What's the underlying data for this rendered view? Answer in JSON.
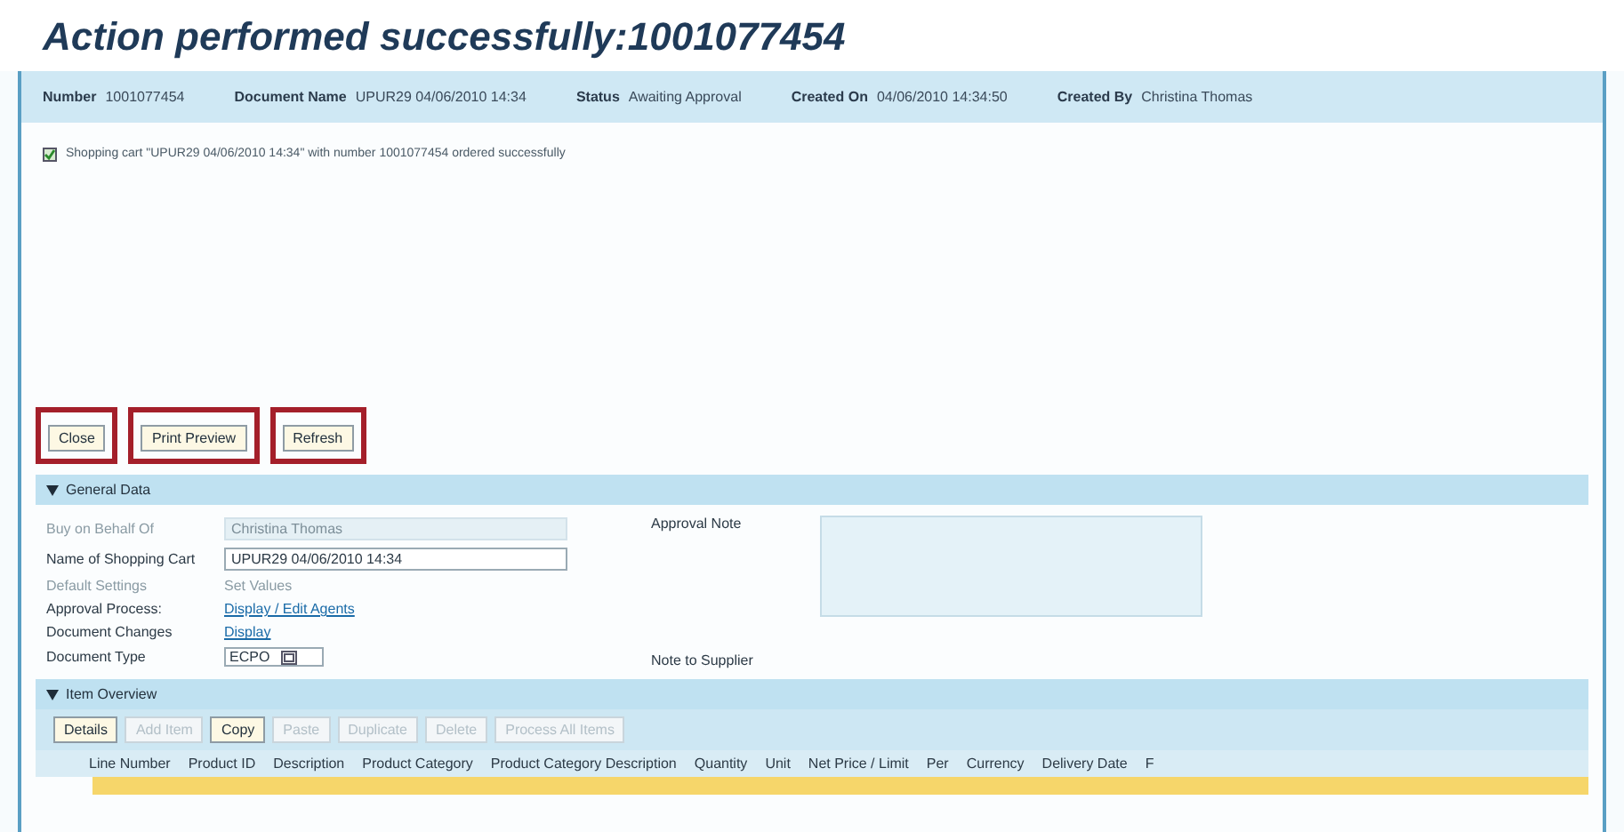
{
  "title": "Action performed successfully:1001077454",
  "header_fields": [
    {
      "label": "Number",
      "value": "1001077454"
    },
    {
      "label": "Document Name",
      "value": "UPUR29 04/06/2010 14:34"
    },
    {
      "label": "Status",
      "value": "Awaiting Approval"
    },
    {
      "label": "Created On",
      "value": "04/06/2010 14:34:50"
    },
    {
      "label": "Created By",
      "value": "Christina Thomas"
    }
  ],
  "message": {
    "kind": "success",
    "text": "Shopping cart \"UPUR29 04/06/2010 14:34\" with number 1001077454 ordered successfully"
  },
  "buttons": [
    {
      "label": "Close",
      "highlighted": true
    },
    {
      "label": "Print Preview",
      "highlighted": true
    },
    {
      "label": "Refresh",
      "highlighted": true
    }
  ],
  "general_data": {
    "title": "General Data",
    "expanded": true,
    "fields": [
      {
        "kind": "input",
        "label": "Buy on Behalf Of",
        "value": "Christina Thomas",
        "disabled": true
      },
      {
        "kind": "input",
        "label": "Name of Shopping Cart",
        "value": "UPUR29 04/06/2010 14:34",
        "disabled": false
      },
      {
        "kind": "text",
        "label": "Default Settings",
        "value": "Set Values",
        "disabled": true
      },
      {
        "kind": "link",
        "label": "Approval Process:",
        "value": "Display / Edit Agents",
        "disabled": false
      },
      {
        "kind": "link",
        "label": "Document Changes",
        "value": "Display",
        "disabled": false
      },
      {
        "kind": "select",
        "label": "Document Type",
        "value": "ECPO",
        "disabled": false
      }
    ],
    "approval_note": {
      "label": "Approval Note"
    },
    "note_to_supplier": {
      "label": "Note to Supplier"
    }
  },
  "item_overview": {
    "title": "Item Overview",
    "expanded": true,
    "toolbar": [
      {
        "label": "Details",
        "disabled": false
      },
      {
        "label": "Add Item",
        "disabled": true
      },
      {
        "label": "Copy",
        "disabled": false
      },
      {
        "label": "Paste",
        "disabled": true
      },
      {
        "label": "Duplicate",
        "disabled": true
      },
      {
        "label": "Delete",
        "disabled": true
      },
      {
        "label": "Process All Items",
        "disabled": true
      }
    ],
    "columns": [
      "Line Number",
      "Product ID",
      "Description",
      "Product Category",
      "Product Category Description",
      "Quantity",
      "Unit",
      "Net Price / Limit",
      "Per",
      "Currency",
      "Delivery Date",
      "F"
    ],
    "rows": [
      {
        "selected": true
      }
    ]
  }
}
